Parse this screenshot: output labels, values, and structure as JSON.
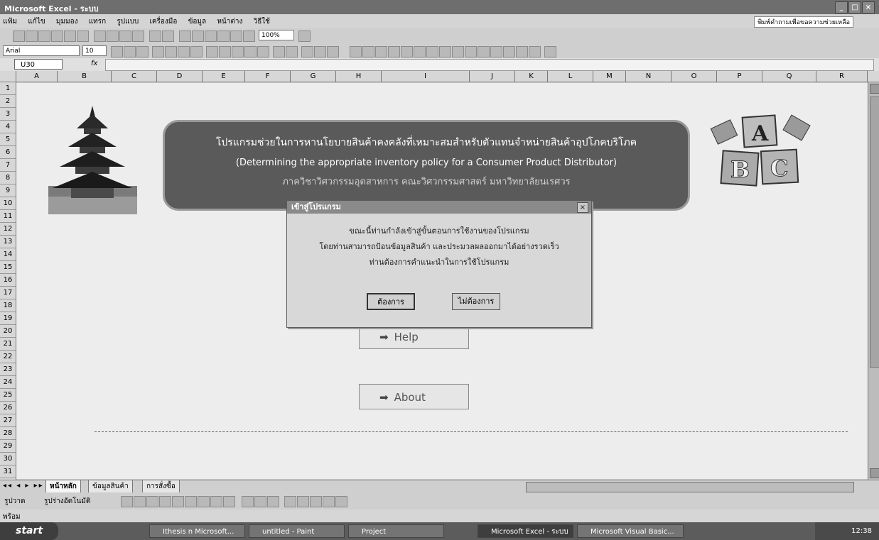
{
  "window": {
    "title": "Microsoft Excel - ระบบ"
  },
  "menu": {
    "items": [
      "แฟ้ม",
      "แก้ไข",
      "มุมมอง",
      "แทรก",
      "รูปแบบ",
      "เครื่องมือ",
      "ข้อมูล",
      "หน้าต่าง",
      "วิธีใช้"
    ],
    "help_box": "พิมพ์คำถามเพื่อขอความช่วยเหลือ"
  },
  "toolbar": {
    "zoom": "100%",
    "font": "Arial",
    "size": "10"
  },
  "formula": {
    "namebox": "U30",
    "fx": "fx"
  },
  "columns": [
    "A",
    "B",
    "C",
    "D",
    "E",
    "F",
    "G",
    "H",
    "I",
    "J",
    "K",
    "L",
    "M",
    "N",
    "O",
    "P",
    "Q",
    "R"
  ],
  "rows": [
    "1",
    "2",
    "3",
    "4",
    "5",
    "6",
    "7",
    "8",
    "9",
    "10",
    "11",
    "12",
    "13",
    "14",
    "15",
    "16",
    "17",
    "18",
    "19",
    "20",
    "21",
    "22",
    "23",
    "24",
    "25",
    "26",
    "27",
    "28",
    "29",
    "30",
    "31"
  ],
  "banner": {
    "line1": "โปรแกรมช่วยในการหานโยบายสินค้าคงคลังที่เหมาะสมสำหรับตัวแทนจำหน่ายสินค้าอุปโภคบริโภค",
    "line2": "(Determining the appropriate inventory policy for a Consumer Product Distributor)",
    "line3": "ภาควิชาวิศวกรรมอุตสาหการ คณะวิศวกรรมศาสตร์ มหาวิทยาลัยนเรศวร"
  },
  "buttons": {
    "help": "Help",
    "about": "About"
  },
  "dialog": {
    "title": "เข้าสู่โปรแกรม",
    "line1": "ขณะนี้ท่านกำลังเข้าสู่ขั้นตอนการใช้งานของโปรแกรม",
    "line2": "โดยท่านสามารถป้อนข้อมูลสินค้า และประมวลผลออกมาได้อย่างรวดเร็ว",
    "line3": "ท่านต้องการคำแนะนำในการใช้โปรแกรม",
    "yes": "ต้องการ",
    "no": "ไม่ต้องการ"
  },
  "sheets": [
    "หน้าหลัก",
    "ข้อมูลสินค้า",
    "การสั่งซื้อ"
  ],
  "drawing": {
    "draw": "รูปวาด",
    "autoshapes": "รูปร่างอัตโนมัติ"
  },
  "status": {
    "text": "พร้อม"
  },
  "taskbar": {
    "start": "start",
    "tasks": [
      "Ithesis n Microsoft...",
      "untitled - Paint",
      "Project",
      "Microsoft Excel - ระบบ",
      "Microsoft Visual Basic..."
    ],
    "clock": "12:38"
  }
}
